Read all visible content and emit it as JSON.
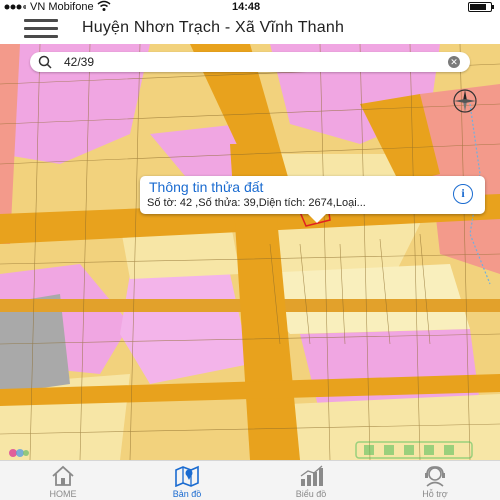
{
  "status_bar": {
    "carrier": "VN Mobifone",
    "time": "14:48",
    "battery_level": 0.8
  },
  "header": {
    "title": "Huyện Nhơn Trạch - Xã Vĩnh Thanh"
  },
  "search": {
    "value": "42/39",
    "clear_icon": "clear-icon"
  },
  "popup": {
    "title": "Thông tin thửa đất",
    "subtitle": "Số tờ: 42 ,Số thửa: 39,Diện tích: 2674,Loại...",
    "info_icon": "info-icon"
  },
  "tabs": [
    {
      "label": "HOME",
      "icon": "home-icon",
      "active": false
    },
    {
      "label": "Bản đồ",
      "icon": "map-icon",
      "active": true
    },
    {
      "label": "Biểu đồ",
      "icon": "chart-icon",
      "active": false
    },
    {
      "label": "Hỗ trợ",
      "icon": "support-icon",
      "active": false
    }
  ],
  "colors": {
    "accent": "#1a6bd0",
    "map_yellow": "#f3c23a",
    "map_orange": "#e8a21d",
    "map_pink": "#f3a6e6",
    "map_beige": "#f6e7a4",
    "map_salmon": "#f39a8b",
    "map_gray": "#a9a9a9"
  }
}
